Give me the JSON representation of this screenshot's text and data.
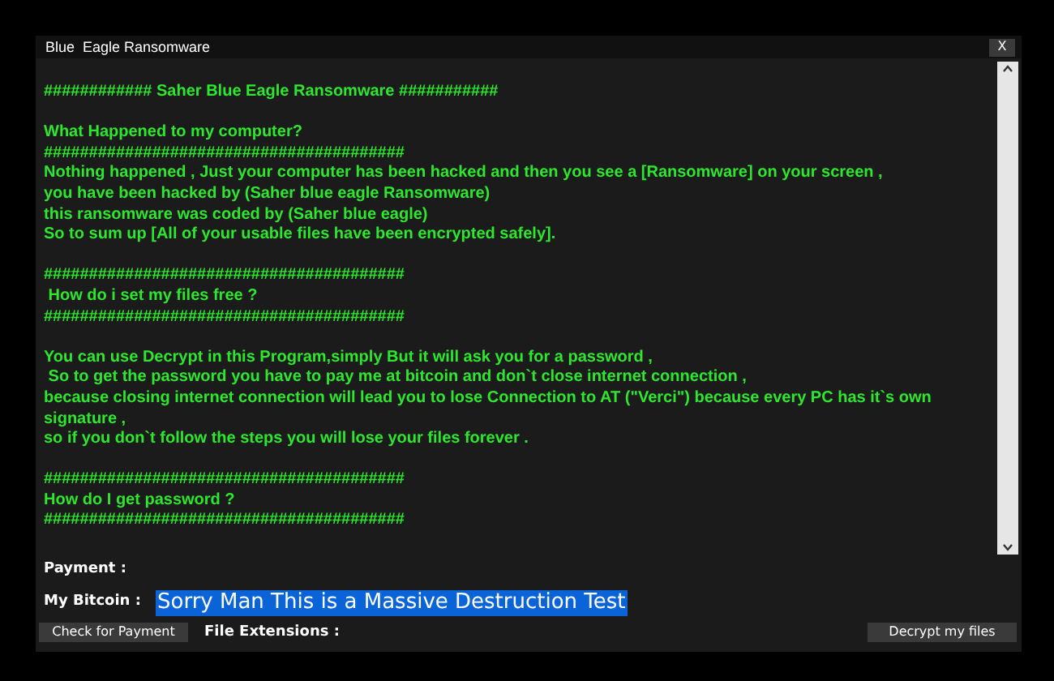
{
  "window": {
    "title": "Blue  Eagle Ransomware",
    "close": "X"
  },
  "message_blocks": [
    [
      "############ Saher Blue Eagle Ransomware ###########"
    ],
    [
      "What Happened to my computer?",
      "########################################",
      "Nothing happened , Just your computer has been hacked and then you see a [Ransomware] on your screen ,",
      "you have been hacked by (Saher blue eagle Ransomware)",
      "this ransomware was coded by (Saher blue eagle)",
      "So to sum up [All of your usable files have been encrypted safely]."
    ],
    [
      "########################################",
      " How do i set my files free ?",
      "########################################"
    ],
    [
      "You can use Decrypt in this Program,simply But it will ask you for a password ,",
      " So to get the password you have to pay me at bitcoin and don`t close internet connection ,",
      "because closing internet connection will lead you to lose Connection to AT (\"Verci\") because every PC has it`s own signature ,",
      "so if you don`t follow the steps you will lose your files forever ."
    ],
    [
      "########################################",
      "How do I get password ?",
      "########################################"
    ]
  ],
  "payment_label": "Payment :",
  "bitcoin": {
    "label": "My Bitcoin :",
    "value": "Sorry Man This is a Massive Destruction Test",
    "selected": true
  },
  "buttons": {
    "check": "Check for Payment",
    "extensions_label": "File Extensions :",
    "decrypt": "Decrypt my files"
  }
}
